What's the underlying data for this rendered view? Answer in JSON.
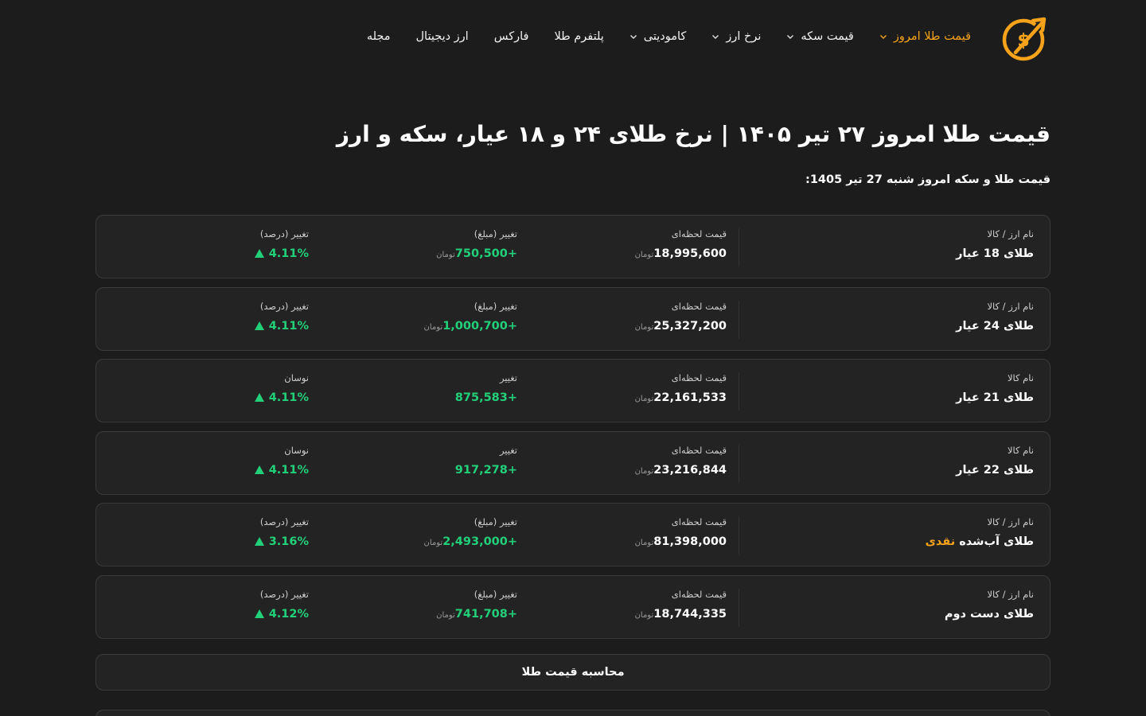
{
  "colors": {
    "accent": "#f7a21b",
    "positive": "#22d07a",
    "background": "#1c1c1c",
    "card": "#232323"
  },
  "nav": {
    "items": [
      {
        "label": "قیمت طلا امروز",
        "has_dropdown": true,
        "active": true
      },
      {
        "label": "قیمت سکه",
        "has_dropdown": true
      },
      {
        "label": "نرخ ارز",
        "has_dropdown": true
      },
      {
        "label": "کامودیتی",
        "has_dropdown": true
      },
      {
        "label": "پلتفرم طلا",
        "has_dropdown": false
      },
      {
        "label": "فارکس",
        "has_dropdown": false
      },
      {
        "label": "ارز دیجیتال",
        "has_dropdown": false
      },
      {
        "label": "مجله",
        "has_dropdown": false
      }
    ]
  },
  "page": {
    "title": "قیمت طلا امروز ۲۷ تیر ۱۴۰۵ | نرخ طلای ۲۴ و ۱۸ عیار، سکه و ارز",
    "subtitle": "قیمت طلا و سکه امروز شنبه 27 تیر 1405:"
  },
  "rows": [
    {
      "name_label": "نام ارز / کالا",
      "name": "طلای 18 عیار",
      "price_label": "قیمت لحظه‌ای",
      "price": "18,995,600",
      "price_unit": "تومان",
      "change_label": "تغییر (مبلغ)",
      "change": "750,500+",
      "change_unit": "تومان",
      "pct_label": "تغییر (درصد)",
      "pct": "4.11%"
    },
    {
      "name_label": "نام ارز / کالا",
      "name": "طلای 24 عیار",
      "price_label": "قیمت لحظه‌ای",
      "price": "25,327,200",
      "price_unit": "تومان",
      "change_label": "تغییر (مبلغ)",
      "change": "1,000,700+",
      "change_unit": "تومان",
      "pct_label": "تغییر (درصد)",
      "pct": "4.11%"
    },
    {
      "name_label": "نام کالا",
      "name": "طلای 21 عیار",
      "price_label": "قیمت لحظه‌ای",
      "price": "22,161,533",
      "price_unit": "تومان",
      "change_label": "تغییر",
      "change": "875,583+",
      "pct_label": "نوسان",
      "pct": "4.11%"
    },
    {
      "name_label": "نام کالا",
      "name": "طلای 22 عیار",
      "price_label": "قیمت لحظه‌ای",
      "price": "23,216,844",
      "price_unit": "تومان",
      "change_label": "تغییر",
      "change": "917,278+",
      "pct_label": "نوسان",
      "pct": "4.11%"
    },
    {
      "name_label": "نام ارز / کالا",
      "name": "طلای آب‌شده",
      "name_highlight": "نقدی",
      "price_label": "قیمت لحظه‌ای",
      "price": "81,398,000",
      "price_unit": "تومان",
      "change_label": "تغییر (مبلغ)",
      "change": "2,493,000+",
      "change_unit": "تومان",
      "pct_label": "تغییر (درصد)",
      "pct": "3.16%"
    },
    {
      "name_label": "نام ارز / کالا",
      "name": "طلای دست دوم",
      "price_label": "قیمت لحظه‌ای",
      "price": "18,744,335",
      "price_unit": "تومان",
      "change_label": "تغییر (مبلغ)",
      "change": "741,708+",
      "change_unit": "تومان",
      "pct_label": "تغییر (درصد)",
      "pct": "4.12%"
    }
  ],
  "calculator": {
    "label": "محاسبه قیمت طلا"
  }
}
